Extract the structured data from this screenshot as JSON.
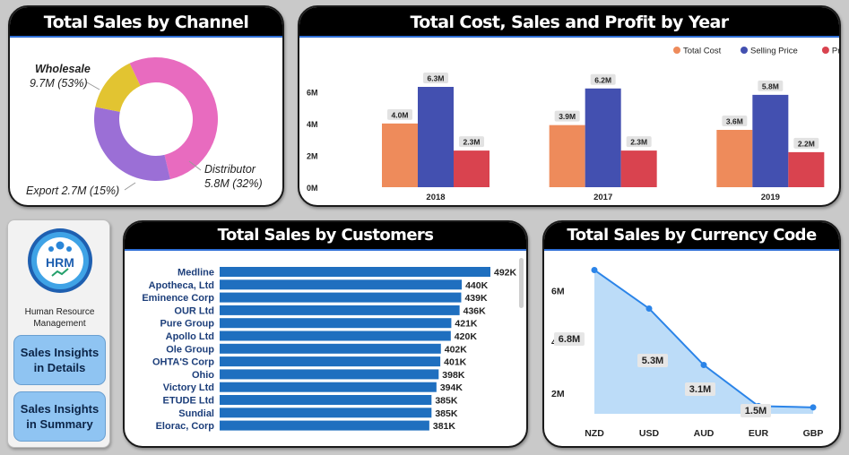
{
  "channel_card": {
    "title": "Total Sales by Channel",
    "labels": {
      "wholesale_name": "Wholesale",
      "wholesale_value": "9.7M (53%)",
      "distributor_name": "Distributor",
      "distributor_value": "5.8M (32%)",
      "export": "Export 2.7M (15%)"
    }
  },
  "year_card": {
    "title": "Total Cost, Sales and Profit by Year"
  },
  "customers_card": {
    "title": "Total Sales by Customers"
  },
  "currency_card": {
    "title": "Total Sales by Currency Code"
  },
  "nav": {
    "org_line1": "Human Resource",
    "org_line2": "Management",
    "logo_text": "HRM",
    "button_details_line1": "Sales Insights",
    "button_details_line2": "in Details",
    "button_summary_line1": "Sales Insights",
    "button_summary_line2": "in Summary"
  },
  "colors": {
    "wholesale": "#e86bbf",
    "distributor": "#9b6fd6",
    "export": "#e2c431",
    "total_cost": "#ee8b5b",
    "selling_price": "#4350b0",
    "profit": "#d9434f",
    "customer_bar": "#1f6fbf",
    "currency_line": "#2b84e8",
    "currency_area": "#bcdcf8"
  },
  "chart_data": [
    {
      "type": "pie",
      "variant": "donut",
      "title": "Total Sales by Channel",
      "slices": [
        {
          "label": "Wholesale",
          "value": 9.7,
          "display": "9.7M (53%)"
        },
        {
          "label": "Distributor",
          "value": 5.8,
          "display": "5.8M (32%)"
        },
        {
          "label": "Export",
          "value": 2.7,
          "display": "2.7M (15%)"
        }
      ]
    },
    {
      "type": "bar",
      "title": "Total Cost, Sales and Profit by Year",
      "categories": [
        "2018",
        "2017",
        "2019"
      ],
      "series": [
        {
          "name": "Total Cost",
          "values": [
            4.0,
            3.9,
            3.6
          ],
          "labels": [
            "4.0M",
            "3.9M",
            "3.6M"
          ]
        },
        {
          "name": "Selling Price",
          "values": [
            6.3,
            6.2,
            5.8
          ],
          "labels": [
            "6.3M",
            "6.2M",
            "5.8M"
          ]
        },
        {
          "name": "Profit",
          "values": [
            2.3,
            2.3,
            2.2
          ],
          "labels": [
            "2.3M",
            "2.3M",
            "2.2M"
          ]
        }
      ],
      "yticks": [
        "0M",
        "2M",
        "4M",
        "6M"
      ],
      "ylim": [
        0,
        7
      ],
      "legend": "top-right"
    },
    {
      "type": "bar",
      "orientation": "horizontal",
      "title": "Total Sales by Customers",
      "categories": [
        "Medline",
        "Apotheca, Ltd",
        "Eminence Corp",
        "OUR Ltd",
        "Pure Group",
        "Apollo Ltd",
        "Ole Group",
        "OHTA'S Corp",
        "Ohio",
        "Victory Ltd",
        "ETUDE Ltd",
        "Sundial",
        "Elorac, Corp"
      ],
      "values": [
        492,
        440,
        439,
        436,
        421,
        420,
        402,
        401,
        398,
        394,
        385,
        385,
        381
      ],
      "labels": [
        "492K",
        "440K",
        "439K",
        "436K",
        "421K",
        "420K",
        "402K",
        "401K",
        "398K",
        "394K",
        "385K",
        "385K",
        "381K"
      ],
      "xlim": [
        0,
        492
      ]
    },
    {
      "type": "area",
      "title": "Total Sales by Currency Code",
      "categories": [
        "NZD",
        "USD",
        "AUD",
        "EUR",
        "GBP"
      ],
      "values": [
        6.8,
        5.3,
        3.1,
        1.5,
        1.45
      ],
      "labels": [
        "6.8M",
        "5.3M",
        "3.1M",
        "1.5M",
        ""
      ],
      "yticks": [
        "2M",
        "4M",
        "6M"
      ],
      "ylim": [
        1.2,
        7.2
      ]
    }
  ]
}
